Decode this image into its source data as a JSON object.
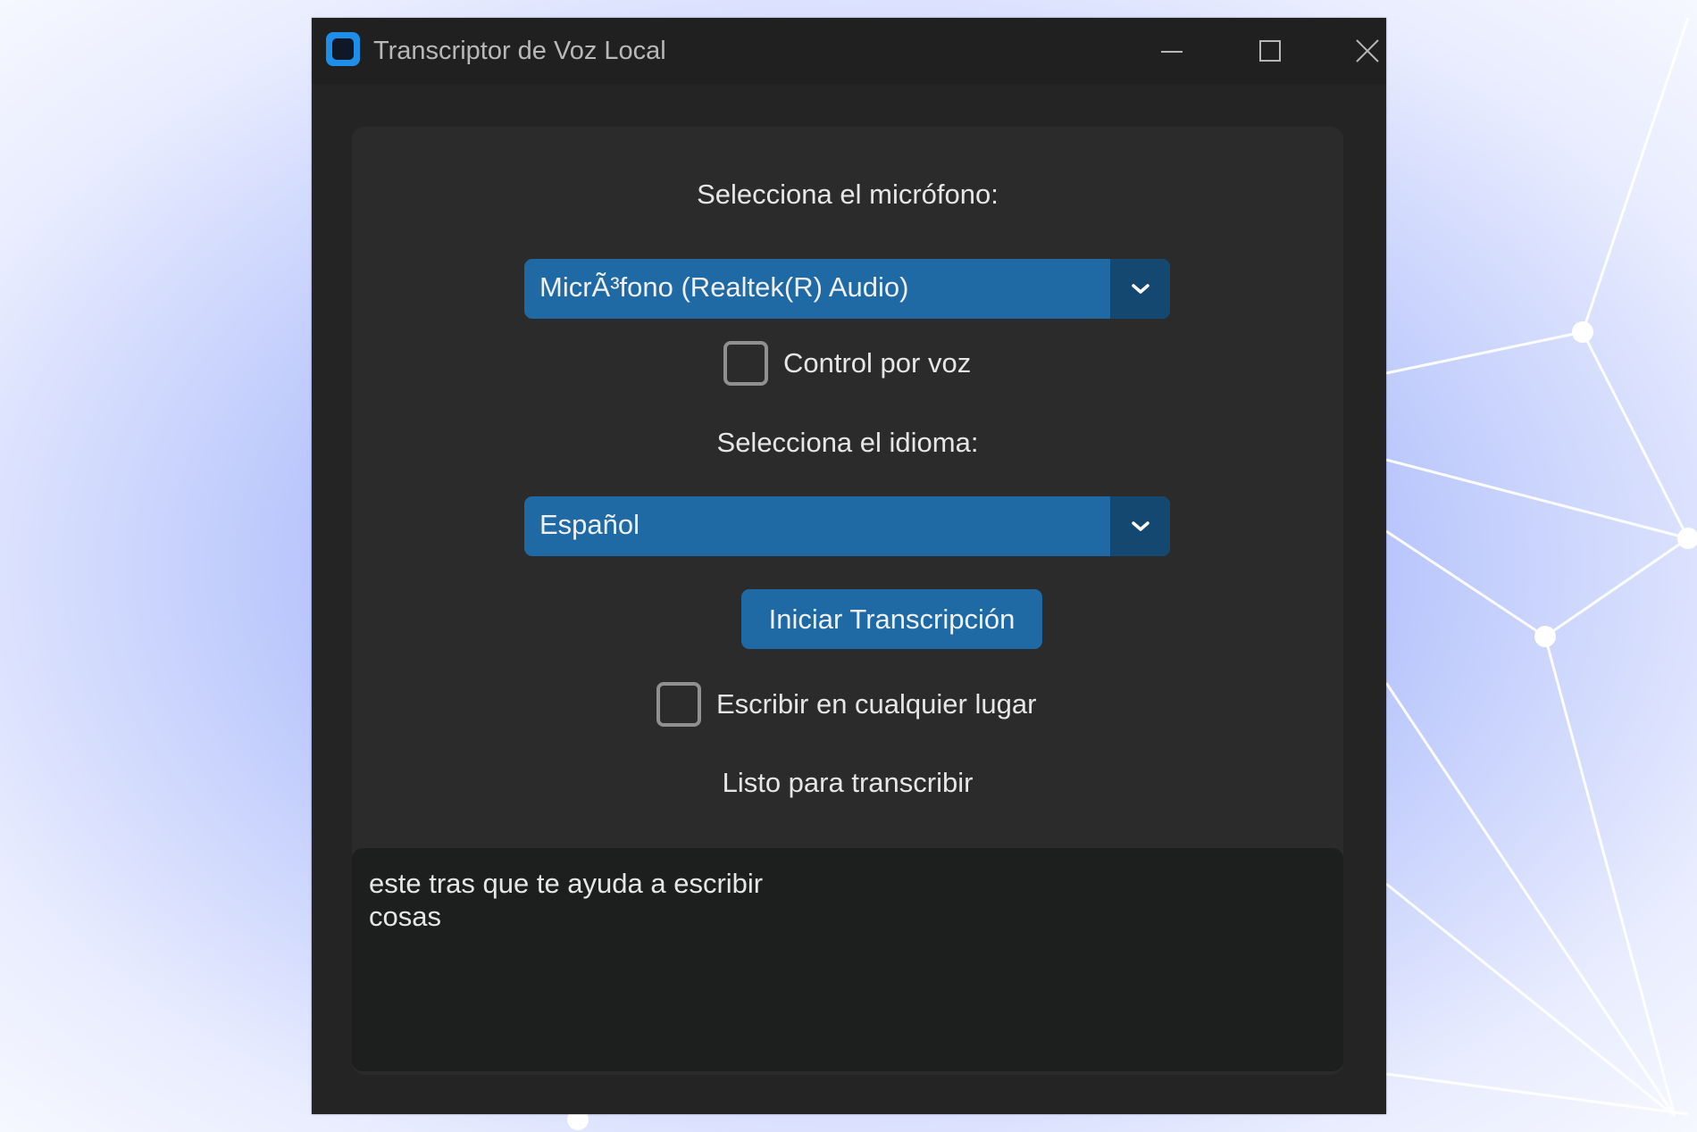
{
  "window": {
    "title": "Transcriptor de Voz Local",
    "controls": [
      "minimize-icon",
      "maximize-icon",
      "close-icon"
    ]
  },
  "form": {
    "mic_label": "Selecciona el micrófono:",
    "mic_selected": "MicrÃ³fono (Realtek(R) Audio)",
    "voice_control_label": "Control por voz",
    "voice_control_checked": false,
    "lang_label": "Selecciona el idioma:",
    "lang_selected": "Español",
    "start_button": "Iniciar Transcripción",
    "write_anywhere_label": "Escribir en cualquier lugar",
    "write_anywhere_checked": false,
    "status": "Listo para transcribir",
    "transcript": "este tras que te ayuda a escribir\ncosas"
  },
  "colors": {
    "accent": "#1f6aa5",
    "accent_dark": "#144870",
    "window_bg": "#242424",
    "panel_bg": "#2b2b2b",
    "textbox_bg": "#1d1e1e"
  }
}
